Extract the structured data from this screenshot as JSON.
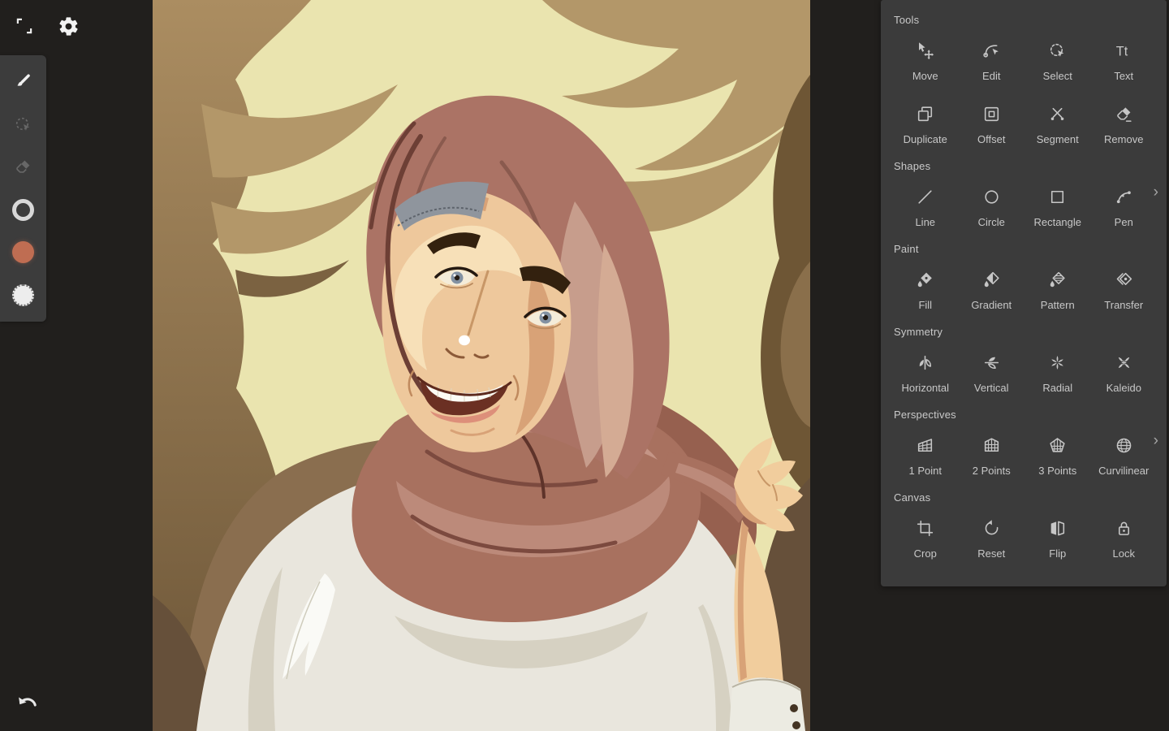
{
  "topbar": {
    "fullscreen_icon": "fullscreen-toggle-icon",
    "settings_icon": "settings-gear-icon"
  },
  "left_toolbar": {
    "items": [
      {
        "icon": "brush-tool-icon",
        "active": true
      },
      {
        "icon": "lasso-select-tool-icon",
        "active": false
      },
      {
        "icon": "eraser-tool-icon",
        "active": false
      },
      {
        "icon": "stroke-style-well",
        "active": true
      },
      {
        "icon": "fill-color-well",
        "color": "#bf6d52"
      },
      {
        "icon": "brush-tip-well",
        "color": "#ededed"
      }
    ]
  },
  "history": {
    "undo_icon": "undo-arrow-icon"
  },
  "panel": {
    "more_glyph": "›",
    "sections": [
      {
        "title": "Tools",
        "items": [
          {
            "label": "Move",
            "icon": "move-icon"
          },
          {
            "label": "Edit",
            "icon": "edit-icon"
          },
          {
            "label": "Select",
            "icon": "select-icon"
          },
          {
            "label": "Text",
            "icon": "text-icon",
            "glyph": "Tt"
          },
          {
            "label": "Duplicate",
            "icon": "duplicate-icon"
          },
          {
            "label": "Offset",
            "icon": "offset-icon"
          },
          {
            "label": "Segment",
            "icon": "segment-icon"
          },
          {
            "label": "Remove",
            "icon": "remove-icon"
          }
        ]
      },
      {
        "title": "Shapes",
        "has_more": true,
        "items": [
          {
            "label": "Line",
            "icon": "line-icon"
          },
          {
            "label": "Circle",
            "icon": "circle-icon"
          },
          {
            "label": "Rectangle",
            "icon": "rectangle-icon"
          },
          {
            "label": "Pen",
            "icon": "pen-icon"
          }
        ]
      },
      {
        "title": "Paint",
        "items": [
          {
            "label": "Fill",
            "icon": "fill-icon"
          },
          {
            "label": "Gradient",
            "icon": "gradient-icon"
          },
          {
            "label": "Pattern",
            "icon": "pattern-icon"
          },
          {
            "label": "Transfer",
            "icon": "transfer-icon"
          }
        ]
      },
      {
        "title": "Symmetry",
        "items": [
          {
            "label": "Horizontal",
            "icon": "horizontal-symmetry-icon"
          },
          {
            "label": "Vertical",
            "icon": "vertical-symmetry-icon"
          },
          {
            "label": "Radial",
            "icon": "radial-symmetry-icon"
          },
          {
            "label": "Kaleido",
            "icon": "kaleido-symmetry-icon"
          }
        ]
      },
      {
        "title": "Perspectives",
        "has_more": true,
        "items": [
          {
            "label": "1 Point",
            "icon": "one-point-perspective-icon"
          },
          {
            "label": "2 Points",
            "icon": "two-points-perspective-icon"
          },
          {
            "label": "3 Points",
            "icon": "three-points-perspective-icon"
          },
          {
            "label": "Curvilinear",
            "icon": "curvilinear-perspective-icon"
          }
        ]
      },
      {
        "title": "Canvas",
        "items": [
          {
            "label": "Crop",
            "icon": "crop-icon"
          },
          {
            "label": "Reset",
            "icon": "reset-icon"
          },
          {
            "label": "Flip",
            "icon": "flip-icon"
          },
          {
            "label": "Lock",
            "icon": "lock-icon"
          }
        ]
      }
    ]
  },
  "palette": {
    "app_bg": "#211f1d",
    "panel_bg": "#3b3b3b",
    "fill_swatch": "#bf6d52",
    "canvas_cream": "#eae4af",
    "canvas_tan": "#b39769",
    "canvas_brown": "#8a6e4f",
    "canvas_dark_brown": "#66503a",
    "hijab": "#a8715f",
    "hijab_light": "#c79d8c",
    "skin": "#eec89c",
    "shirt": "#e9e6dd"
  },
  "canvas": {
    "description": "vector portrait of a smiling young woman wearing a hijab, holding its edge with her raised hand"
  }
}
